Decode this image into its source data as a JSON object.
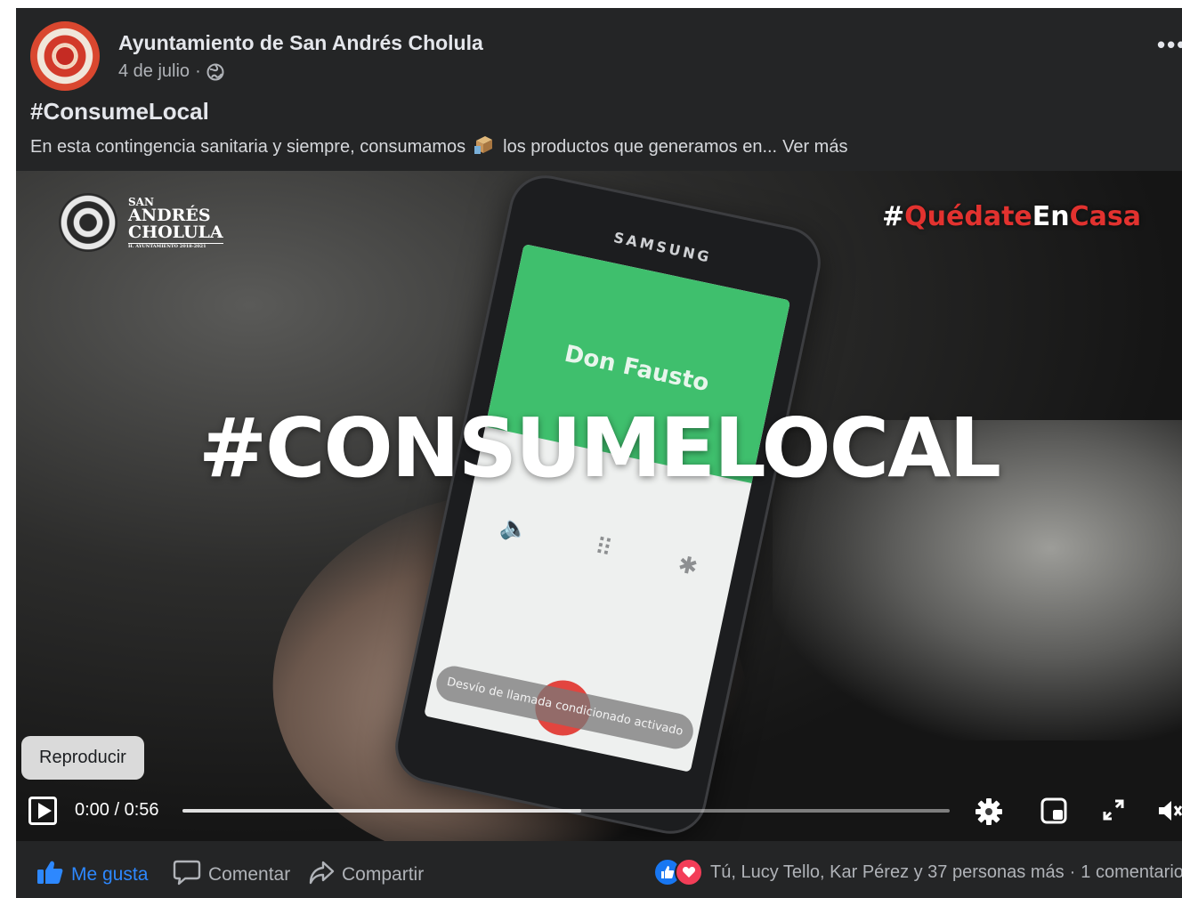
{
  "post": {
    "page_name": "Ayuntamiento de San Andrés Cholula",
    "date": "4 de julio",
    "separator": "·",
    "hashtag_title": "#ConsumeLocal",
    "text_before_icon": "En esta contingencia sanitaria y siempre, consumamos",
    "text_after_icon": "los productos que generamos en...",
    "see_more": "Ver más"
  },
  "video": {
    "logo": {
      "line1": "SAN",
      "line2": "ANDRÉS",
      "line3": "CHOLULA",
      "line4": "H. AYUNTAMIENTO 2018-2021"
    },
    "quedate": {
      "hash": "#",
      "part1": "Quédate",
      "part2": "En",
      "part3": "Casa"
    },
    "overlay_text": "#CONSUMELOCAL",
    "phone": {
      "brand": "SAMSUNG",
      "caller": "Don Fausto",
      "toast": "Desvío de llamada condicionado activado"
    },
    "play_tooltip": "Reproducir",
    "time_display": "0:00 / 0:56",
    "buffered_fraction": 0.52
  },
  "footer": {
    "like_label": "Me gusta",
    "comment_label": "Comentar",
    "share_label": "Compartir",
    "reaction_summary": "Tú, Lucy Tello, Kar Pérez y 37 personas más",
    "separator": "·",
    "comment_count": "1 comentario"
  },
  "colors": {
    "background": "#242526",
    "text_primary": "#e4e6eb",
    "text_secondary": "#b0b3b8",
    "like_blue": "#2d88ff",
    "love_red": "#f33e58",
    "quedate_red": "#e2322f"
  }
}
